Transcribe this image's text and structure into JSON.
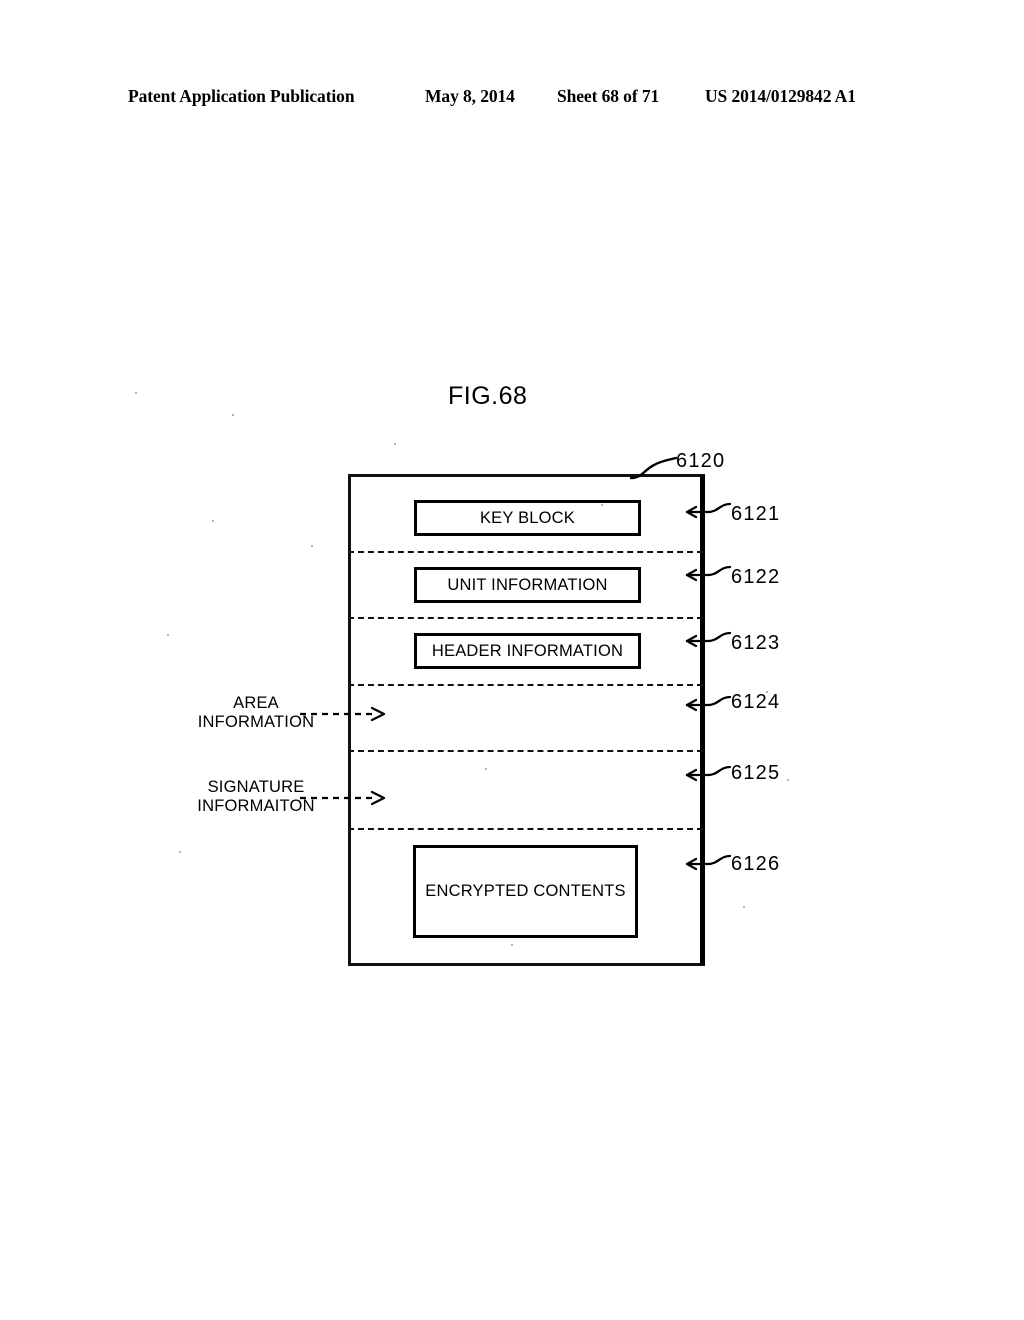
{
  "header": {
    "publication": "Patent Application Publication",
    "date": "May 8, 2014",
    "sheet": "Sheet 68 of 71",
    "patent_number": "US 2014/0129842 A1"
  },
  "figure": {
    "title": "FIG.68",
    "container_ref": "6120",
    "bands": [
      {
        "ref": "6121",
        "label": "KEY BLOCK",
        "has_box": true
      },
      {
        "ref": "6122",
        "label": "UNIT INFORMATION",
        "has_box": true
      },
      {
        "ref": "6123",
        "label": "HEADER INFORMATION",
        "has_box": true
      },
      {
        "ref": "6124",
        "label": "",
        "has_box": false
      },
      {
        "ref": "6125",
        "label": "",
        "has_box": false
      },
      {
        "ref": "6126",
        "label": "ENCRYPTED CONTENTS",
        "has_box": true
      }
    ],
    "callouts": [
      {
        "line1": "AREA",
        "line2": "INFORMATION",
        "target_ref": "6124"
      },
      {
        "line1": "SIGNATURE",
        "line2": "INFORMAITON",
        "target_ref": "6125"
      }
    ]
  },
  "colors": {
    "ink": "#000000",
    "paper": "#ffffff"
  }
}
